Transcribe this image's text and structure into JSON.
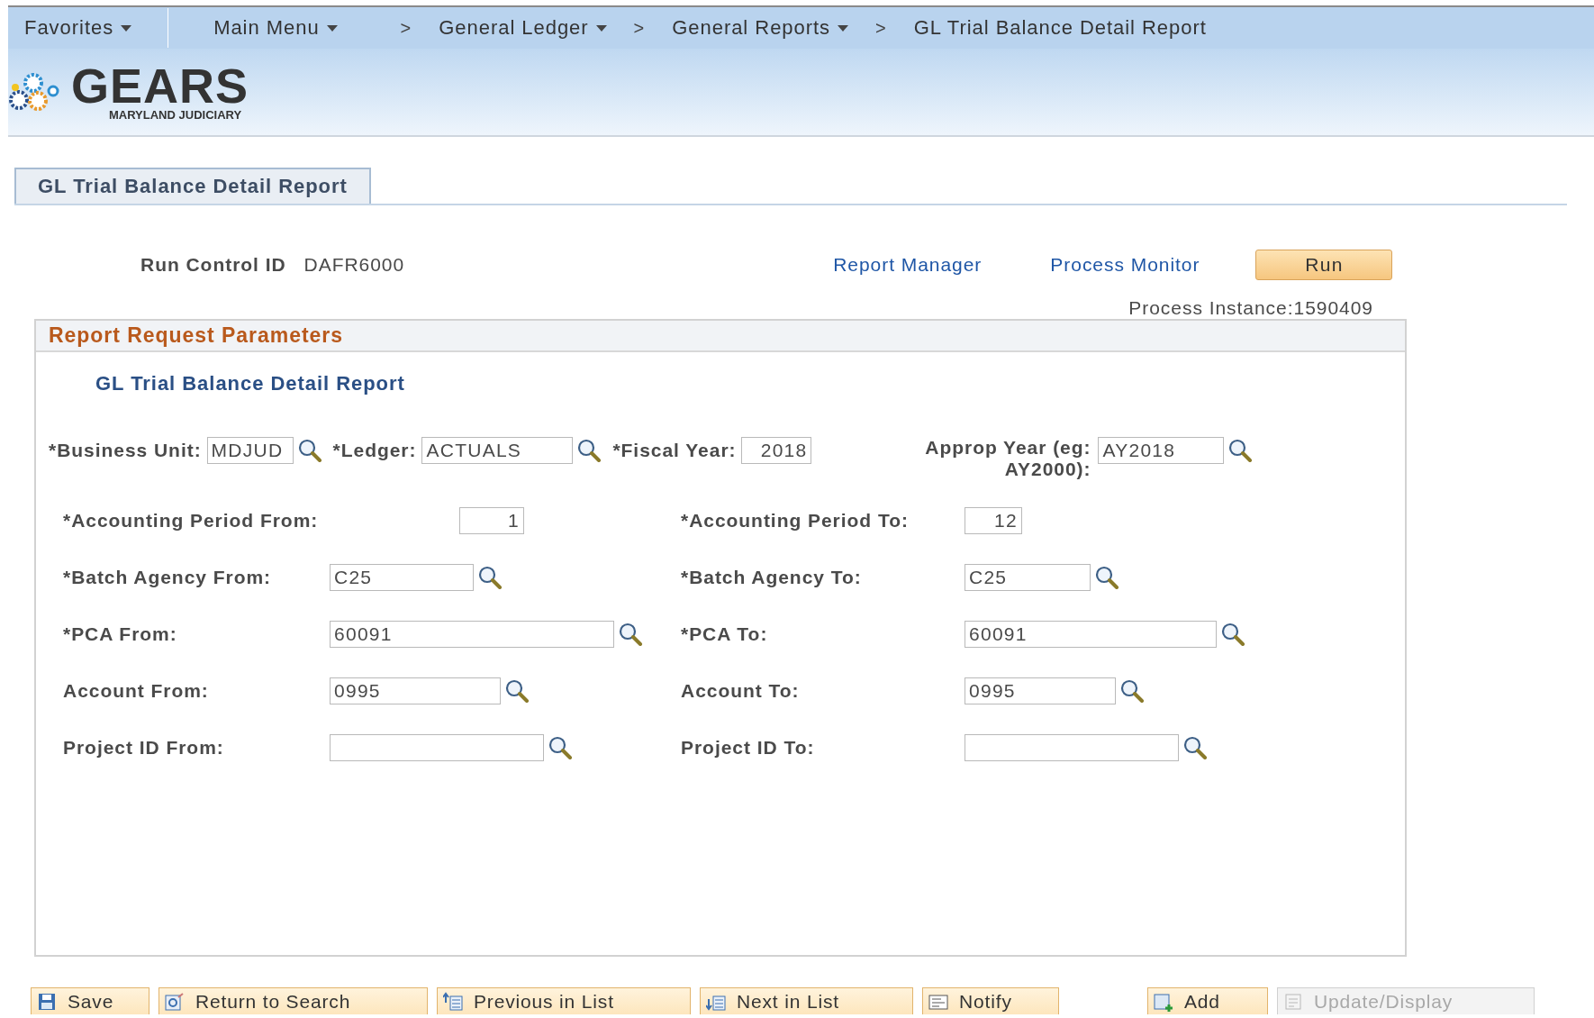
{
  "nav": [
    {
      "label": "Favorites",
      "kind": "menu"
    },
    {
      "label": "Main Menu",
      "kind": "menu"
    },
    {
      "label": ">",
      "kind": "separator"
    },
    {
      "label": "General Ledger",
      "kind": "menu"
    },
    {
      "label": ">",
      "kind": "separator"
    },
    {
      "label": "General Reports",
      "kind": "menu"
    },
    {
      "label": ">",
      "kind": "separator"
    },
    {
      "label": "GL Trial Balance Detail Report",
      "kind": "page"
    }
  ],
  "brand": {
    "name": "GEARS",
    "subtitle": "MARYLAND JUDICIARY"
  },
  "page_tab": {
    "label": "GL Trial Balance Detail Report"
  },
  "run_control": {
    "label": "Run Control ID",
    "value": "DAFR6000",
    "links": [
      "Report Manager",
      "Process Monitor"
    ],
    "run_button": "Run",
    "process_instance": "Process Instance:1590409"
  },
  "parameters": {
    "title": "Report Request Parameters",
    "subtitle": "GL Trial Balance Detail Report",
    "top_row": [
      {
        "label": "*Business Unit:",
        "value": "MDJUD",
        "kind": "text",
        "lookup": true
      },
      {
        "label": "*Ledger:",
        "value": "ACTUALS",
        "kind": "text",
        "lookup": true
      },
      {
        "label": "*Fiscal Year:",
        "value": "2018",
        "kind": "number",
        "lookup": false
      },
      {
        "label": "Approp Year (eg: AY2000):",
        "value": "AY2018",
        "kind": "text",
        "lookup": true
      }
    ],
    "rows": [
      {
        "from": {
          "label": "*Accounting Period From:",
          "value": "1",
          "kind": "number",
          "lookup": false
        },
        "to": {
          "label": "*Accounting Period To:",
          "value": "12",
          "kind": "number",
          "lookup": false
        }
      },
      {
        "from": {
          "label": "*Batch Agency From:",
          "value": "C25",
          "kind": "text",
          "lookup": true
        },
        "to": {
          "label": "*Batch Agency To:",
          "value": "C25",
          "kind": "text",
          "lookup": true
        }
      },
      {
        "from": {
          "label": "*PCA From:",
          "value": "60091",
          "kind": "text",
          "lookup": true
        },
        "to": {
          "label": "*PCA To:",
          "value": "60091",
          "kind": "text",
          "lookup": true
        }
      },
      {
        "from": {
          "label": "Account From:",
          "value": "0995",
          "kind": "text",
          "lookup": true
        },
        "to": {
          "label": "Account To:",
          "value": "0995",
          "kind": "text",
          "lookup": true
        }
      },
      {
        "from": {
          "label": "Project ID From:",
          "kind": "text",
          "lookup": true
        },
        "to": {
          "label": "Project ID To:",
          "kind": "text",
          "lookup": true
        }
      }
    ]
  },
  "toolbar": [
    {
      "label": "Save",
      "disabled": false
    },
    {
      "label": "Return to Search",
      "disabled": false
    },
    {
      "label": "Previous in List",
      "disabled": false
    },
    {
      "label": "Next in List",
      "disabled": false
    },
    {
      "label": "Notify",
      "disabled": false
    },
    {
      "label": "Add",
      "disabled": false
    },
    {
      "label": "Update/Display",
      "disabled": true
    }
  ]
}
